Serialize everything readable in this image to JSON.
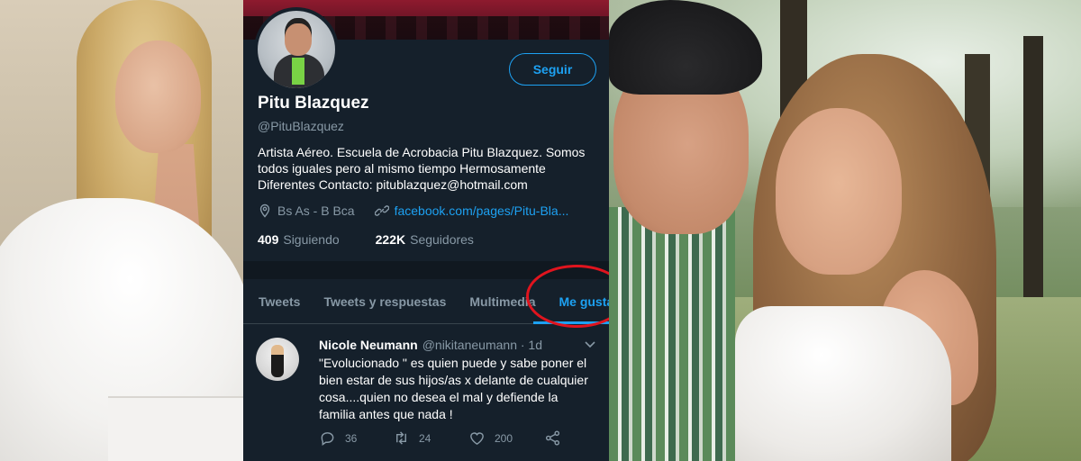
{
  "profile": {
    "name": "Pitu Blazquez",
    "handle": "@PituBlazquez",
    "follow_label": "Seguir",
    "bio": "Artista Aéreo. Escuela de Acrobacia Pitu Blazquez. Somos todos iguales pero al mismo tiempo Hermosamente Diferentes  Contacto: pitublazquez@hotmail.com",
    "location": "Bs As - B Bca",
    "link": "facebook.com/pages/Pitu-Bla...",
    "following_count": "409",
    "following_label": "Siguiendo",
    "followers_count": "222K",
    "followers_label": "Seguidores"
  },
  "tabs": [
    {
      "label": "Tweets"
    },
    {
      "label": "Tweets y respuestas"
    },
    {
      "label": "Multimedia"
    },
    {
      "label": "Me gusta"
    }
  ],
  "active_tab": "Me gusta",
  "tweet": {
    "author_name": "Nicole Neumann",
    "author_handle": "@nikitaneumann · 1d",
    "text": "\"Evolucionado \" es quien puede y sabe poner el bien estar de sus hijos/as x delante de cualquier cosa....quien no desea el mal y defiende la familia antes que nada !",
    "replies": "36",
    "retweets": "24",
    "likes": "200"
  },
  "colors": {
    "background": "#15202b",
    "accent": "#1da1f2",
    "muted": "#8899a6",
    "highlight_circle": "#e0141e"
  },
  "icons": {
    "location": "location-pin-icon",
    "link": "link-icon",
    "reply": "reply-icon",
    "retweet": "retweet-icon",
    "like": "heart-icon",
    "share": "share-icon",
    "menu": "chevron-down-icon"
  }
}
